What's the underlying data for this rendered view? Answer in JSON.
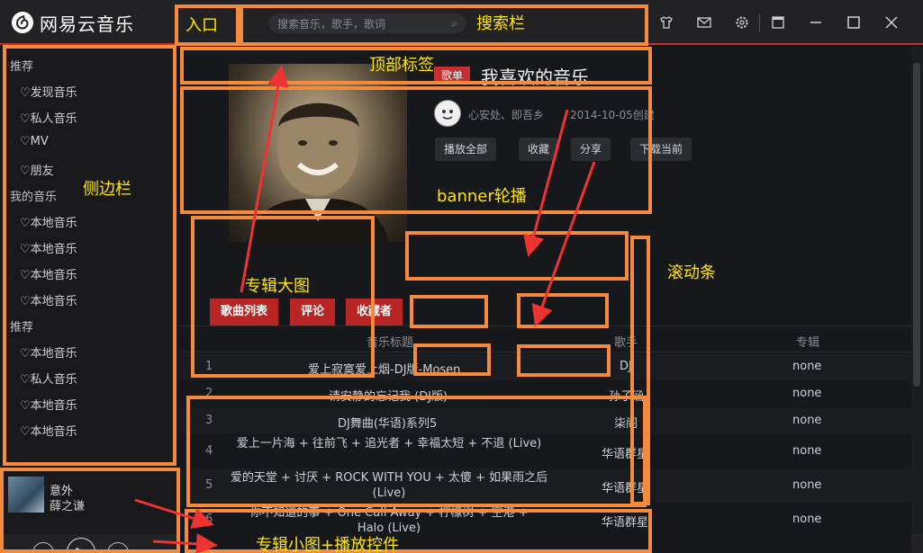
{
  "app": {
    "logo_text": "网易云音乐",
    "accent": "#c62f2f"
  },
  "search": {
    "placeholder": "搜索音乐，歌手，歌词"
  },
  "topbar_icons": [
    "shirt-icon",
    "mail-icon",
    "gear-icon",
    "mini-mode-icon",
    "minimize-icon",
    "maximize-icon",
    "close-icon"
  ],
  "sidebar": {
    "sections": [
      {
        "title": "推荐",
        "items": [
          "♡发现音乐",
          "♡私人音乐",
          "♡MV",
          "♡朋友"
        ]
      },
      {
        "title": "我的音乐",
        "items": [
          "♡本地音乐",
          "♡本地音乐",
          "♡本地音乐",
          "♡本地音乐"
        ]
      },
      {
        "title": "推荐",
        "items": [
          "♡本地音乐",
          "♡私人音乐",
          "♡本地音乐",
          "♡本地音乐"
        ]
      }
    ]
  },
  "now_playing": {
    "title": "意外",
    "artist": "薛之谦"
  },
  "playlist": {
    "tag": "歌单",
    "title": "我喜欢的音乐",
    "owner": "心安处、即吾乡",
    "created": "2014-10-05创建",
    "actions": [
      "播放全部",
      "收藏",
      "分享",
      "下载当前"
    ],
    "tabs": [
      "歌曲列表",
      "评论",
      "收藏者"
    ]
  },
  "table": {
    "headers": [
      "音乐标题",
      "歌手",
      "专辑"
    ],
    "rows": [
      {
        "num": "1",
        "title": "爱上寂寞爱上烟-DJ版-Mosen",
        "artist": "DJ",
        "album": "none"
      },
      {
        "num": "2",
        "title": "请安静的忘记我 (DJ版)",
        "artist": "孙子涵",
        "album": "none"
      },
      {
        "num": "3",
        "title": "DJ舞曲(华语)系列5",
        "artist": "柒阁",
        "album": "none"
      },
      {
        "num": "4",
        "title": "爱上一片海 + 往前飞 + 追光者 + 幸福太短 + 不退 (Live)",
        "artist": "华语群星",
        "album": "none"
      },
      {
        "num": "5",
        "title": "爱的天堂 + 讨厌 + ROCK WITH YOU + 太傻 + 如果雨之后 (Live)",
        "artist": "华语群星",
        "album": "none"
      },
      {
        "num": "6",
        "title": "你不知道的事 + One Call Away + 柠檬树 + 空港 + Halo (Live)",
        "artist": "华语群星",
        "album": "none"
      }
    ]
  },
  "annotations": {
    "entry": "入口",
    "searchbar": "搜索栏",
    "top_tabs": "顶部标签",
    "sidebar": "侧边栏",
    "banner": "banner轮播",
    "album_big": "专辑大图",
    "scrollbar": "滚动条",
    "player": "专辑小图+播放控件",
    "color_box": "#f58a3a",
    "color_text": "#ffe600",
    "color_arrow": "#ee3333"
  }
}
